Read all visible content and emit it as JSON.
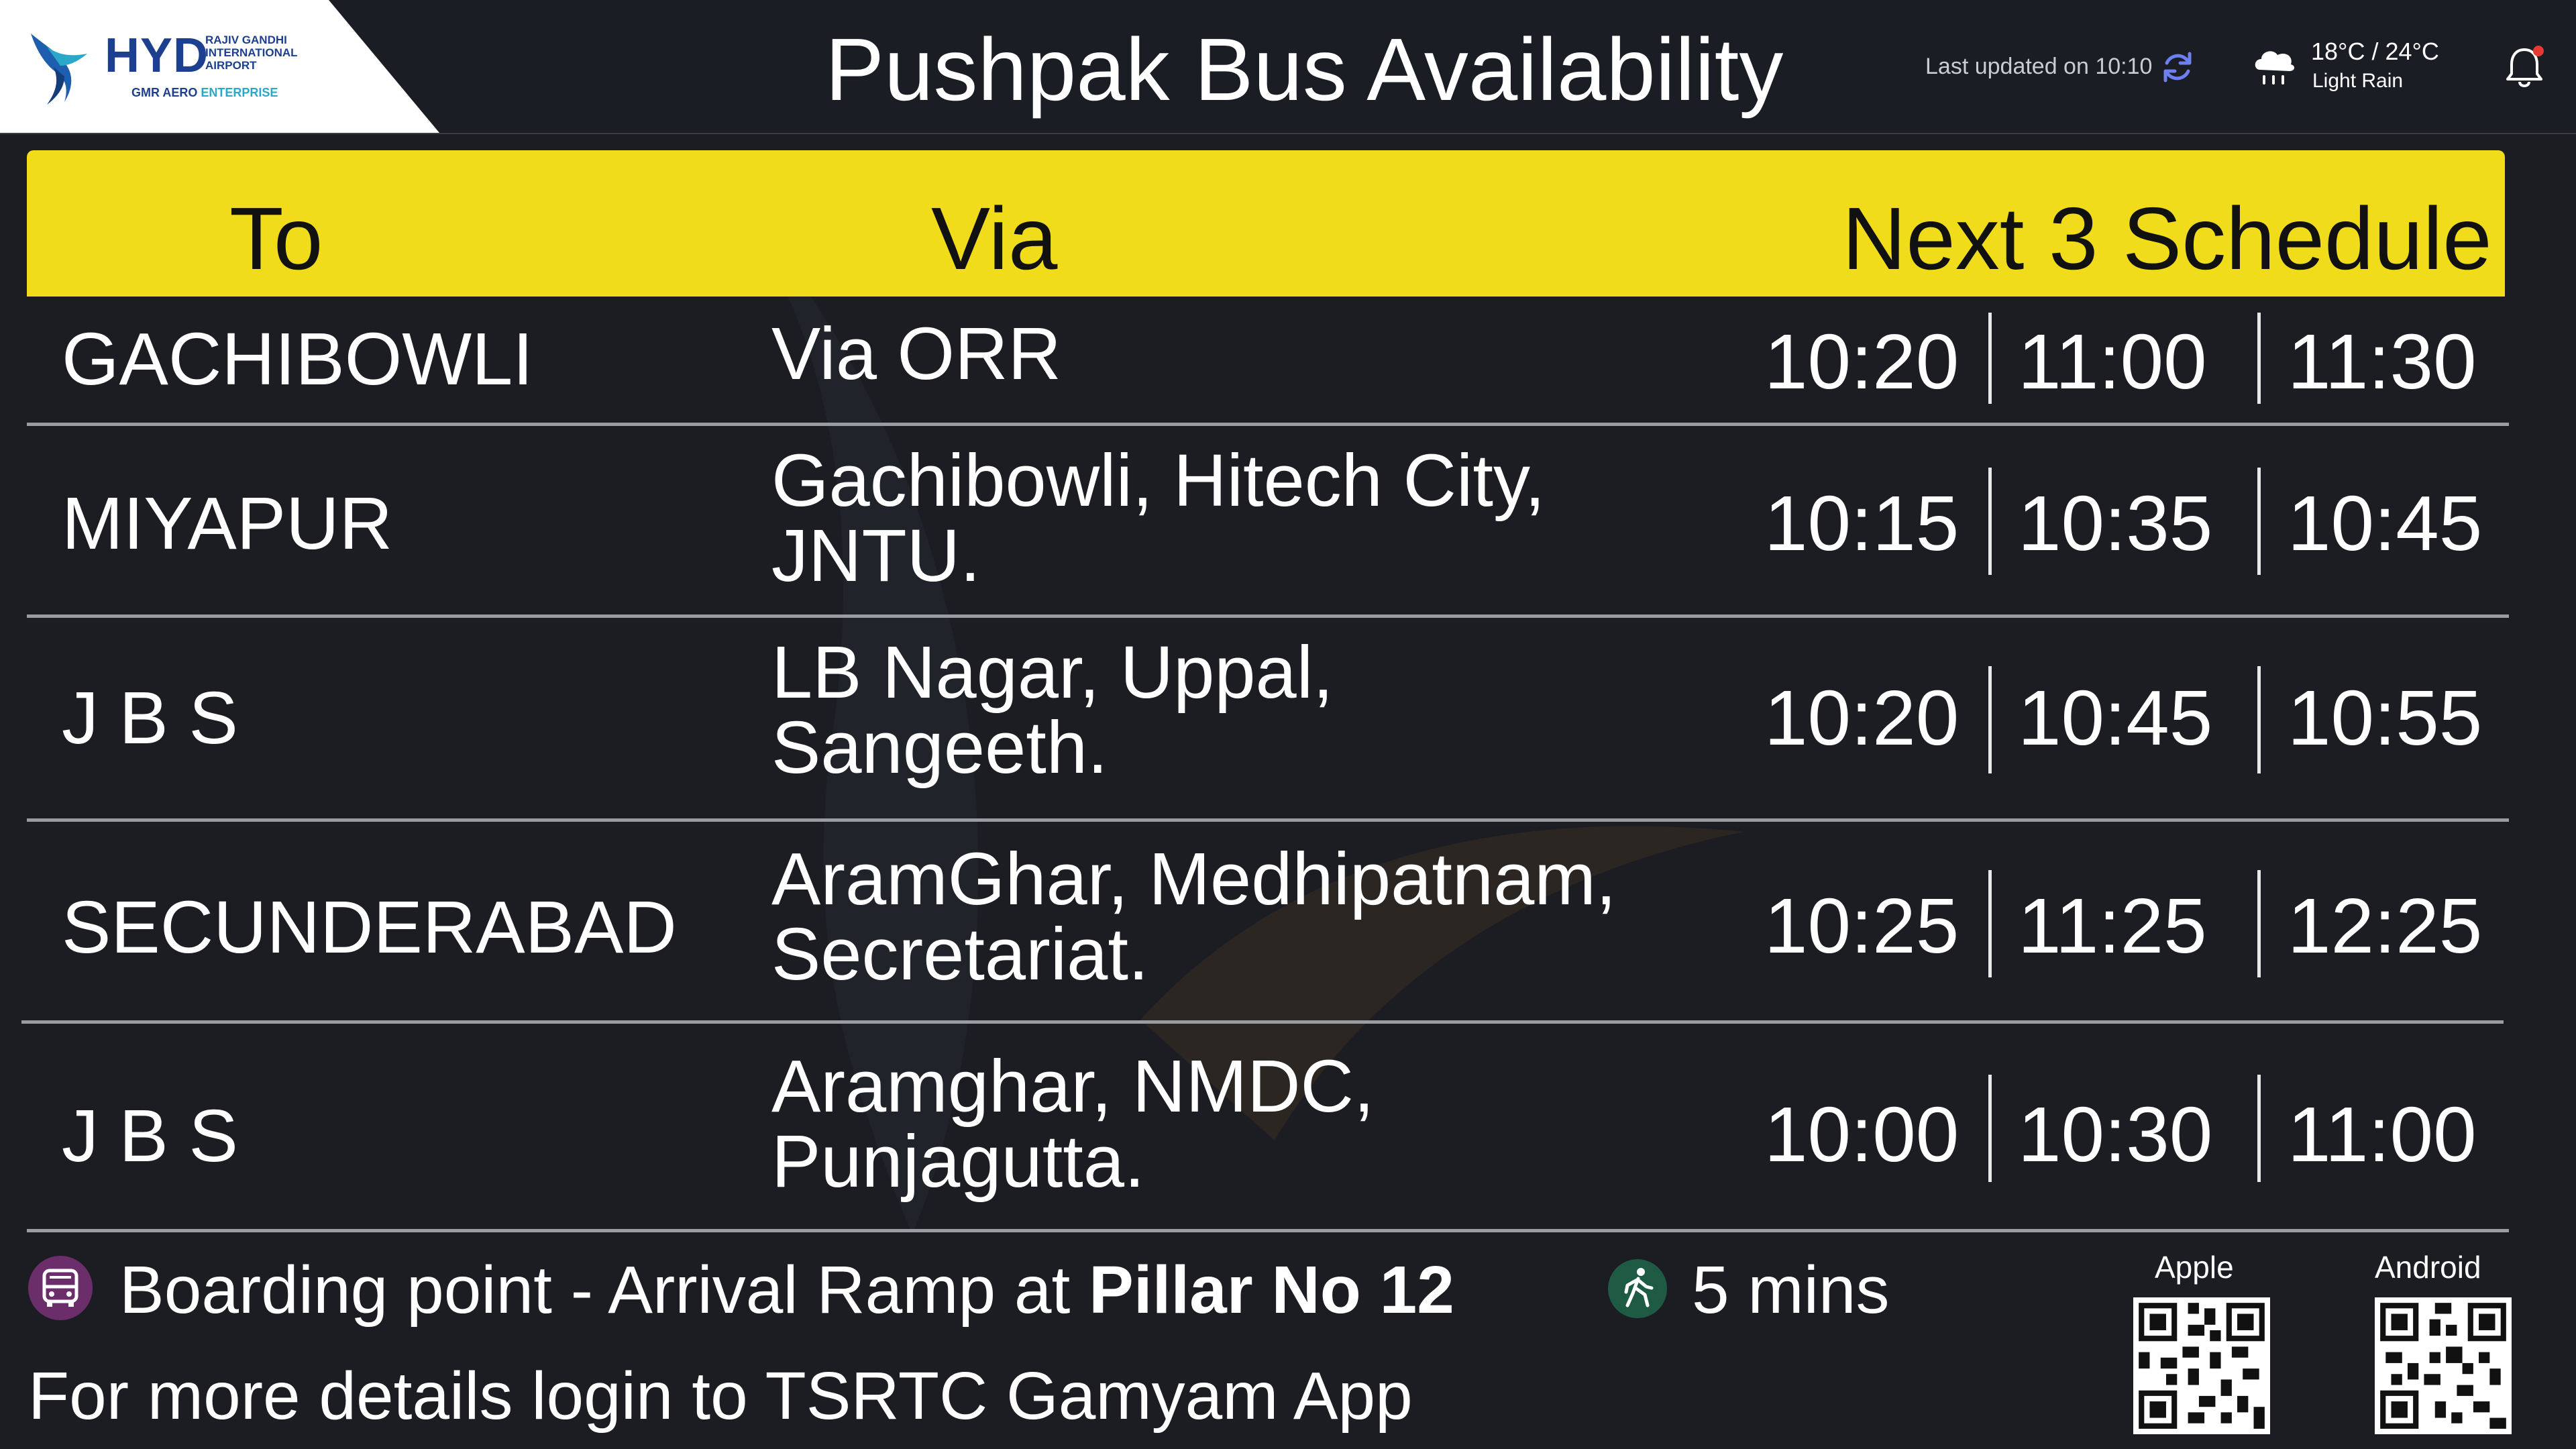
{
  "header": {
    "logo": {
      "code": "HYD",
      "airport_name": "RAJIV GANDHI INTERNATIONAL AIRPORT",
      "enterprise_brand": "GMR AERO",
      "enterprise_suffix": "ENTERPRISE"
    },
    "title": "Pushpak Bus Availability",
    "last_updated": "Last updated on 10:10",
    "weather": {
      "temperature": "18°C / 24°C",
      "condition": "Light Rain"
    }
  },
  "table": {
    "columns": {
      "to": "To",
      "via": "Via",
      "schedule": "Next 3 Schedule"
    },
    "rows": [
      {
        "to": "GACHIBOWLI",
        "via": "Via ORR",
        "times": [
          "10:20",
          "11:00",
          "11:30"
        ]
      },
      {
        "to": "MIYAPUR",
        "via": "Gachibowli, Hitech City,\nJNTU.",
        "times": [
          "10:15",
          "10:35",
          "10:45"
        ]
      },
      {
        "to": "J B S",
        "via": "LB Nagar, Uppal,\nSangeeth.",
        "times": [
          "10:20",
          "10:45",
          "10:55"
        ]
      },
      {
        "to": "SECUNDERABAD",
        "via": "AramGhar, Medhipatnam,\nSecretariat.",
        "times": [
          "10:25",
          "11:25",
          "12:25"
        ]
      },
      {
        "to": "J B S",
        "via": "Aramghar, NMDC,\nPunjagutta.",
        "times": [
          "10:00",
          "10:30",
          "11:00"
        ]
      }
    ]
  },
  "footer": {
    "boarding_prefix": "Boarding point  - Arrival Ramp at ",
    "boarding_bold": "Pillar No 12",
    "walk_time": "5 mins",
    "more_details": "For more details login to TSRTC Gamyam App",
    "qr_apple_label": "Apple",
    "qr_android_label": "Android"
  },
  "icons": {
    "refresh": "refresh-icon",
    "weather": "rain-cloud-icon",
    "notification": "bell-icon",
    "bus": "bus-icon",
    "walk": "walking-person-icon"
  },
  "colors": {
    "header_band": "#f1dc1b",
    "background": "#1b1d22",
    "accent_blue": "#1d3f8f",
    "bus_icon_bg": "#6c2d6b",
    "walk_icon_bg": "#1f5a45",
    "bell_dot": "#e53935"
  }
}
